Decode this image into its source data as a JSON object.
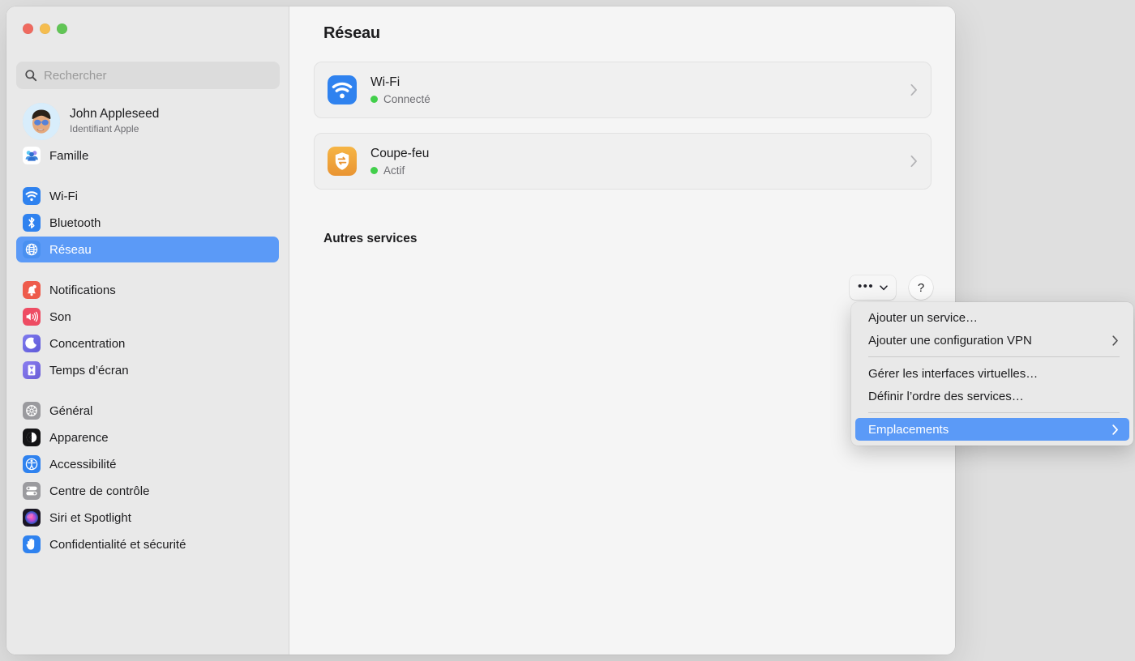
{
  "window": {
    "traffic_lights": [
      "close",
      "minimize",
      "zoom"
    ]
  },
  "sidebar": {
    "search": {
      "placeholder": "Rechercher",
      "value": "",
      "icon": "search-icon"
    },
    "account": {
      "name": "John Appleseed",
      "subtitle": "Identifiant Apple",
      "avatar": "memoji-avatar"
    },
    "groups": [
      {
        "items": [
          {
            "label": "Famille",
            "icon": "family-icon"
          }
        ]
      },
      {
        "items": [
          {
            "label": "Wi-Fi",
            "icon": "wifi-icon",
            "selected": false
          },
          {
            "label": "Bluetooth",
            "icon": "bluetooth-icon",
            "selected": false
          },
          {
            "label": "Réseau",
            "icon": "network-globe-icon",
            "selected": true
          }
        ]
      },
      {
        "items": [
          {
            "label": "Notifications",
            "icon": "notifications-bell-icon"
          },
          {
            "label": "Son",
            "icon": "sound-speaker-icon"
          },
          {
            "label": "Concentration",
            "icon": "focus-moon-icon"
          },
          {
            "label": "Temps d’écran",
            "icon": "screen-time-hourglass-icon"
          }
        ]
      },
      {
        "items": [
          {
            "label": "Général",
            "icon": "general-gear-icon"
          },
          {
            "label": "Apparence",
            "icon": "appearance-contrast-icon"
          },
          {
            "label": "Accessibilité",
            "icon": "accessibility-icon"
          },
          {
            "label": "Centre de contrôle",
            "icon": "control-center-icon"
          },
          {
            "label": "Siri et Spotlight",
            "icon": "siri-icon"
          },
          {
            "label": "Confidentialité et sécurité",
            "icon": "privacy-hand-icon"
          }
        ]
      }
    ]
  },
  "main": {
    "title": "Réseau",
    "services": [
      {
        "name": "Wi-Fi",
        "status": "Connecté",
        "status_color": "#42cf4b",
        "icon": "wifi-icon",
        "disclosure": "chevron-right-icon"
      },
      {
        "name": "Coupe-feu",
        "status": "Actif",
        "status_color": "#42cf4b",
        "icon": "firewall-shield-icon",
        "disclosure": "chevron-right-icon"
      }
    ],
    "section_title": "Autres services",
    "toolbar": {
      "more_label": "•••",
      "more_icon": "chevron-down-icon",
      "help_label": "?"
    }
  },
  "menu": {
    "items": [
      {
        "label": "Ajouter un service…",
        "submenu": false,
        "highlighted": false
      },
      {
        "label": "Ajouter une configuration VPN",
        "submenu": true,
        "highlighted": false
      },
      {
        "separator": true
      },
      {
        "label": "Gérer les interfaces virtuelles…",
        "submenu": false,
        "highlighted": false
      },
      {
        "label": "Définir l’ordre des services…",
        "submenu": false,
        "highlighted": false
      },
      {
        "separator": true
      },
      {
        "label": "Emplacements",
        "submenu": true,
        "highlighted": true
      }
    ]
  },
  "colors": {
    "accent_blue": "#5b9af7",
    "sidebar_bg": "#e9e9e9",
    "content_bg": "#f5f5f5",
    "desktop_bg": "#dfdfdf",
    "status_green": "#42cf4b"
  }
}
